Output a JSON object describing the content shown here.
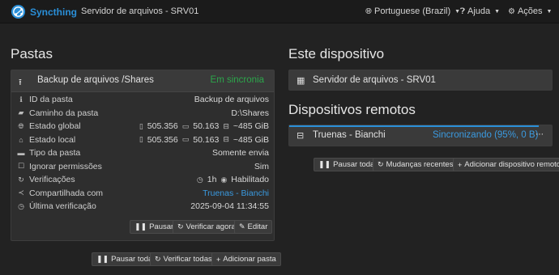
{
  "navbar": {
    "brand": "Syncthing",
    "title": "Servidor de arquivos - SRV01",
    "language": "Portuguese (Brazil)",
    "help": "Ajuda",
    "actions": "Ações"
  },
  "folders": {
    "heading": "Pastas",
    "folder": {
      "name": "Backup de arquivos /Shares",
      "status": "Em sincronia",
      "rows": {
        "id_label": "ID da pasta",
        "id_value": "Backup de arquivos",
        "path_label": "Caminho da pasta",
        "path_value": "D:\\Shares",
        "global_label": "Estado global",
        "global_files": "505.356",
        "global_dirs": "50.163",
        "global_size": "~485 GiB",
        "local_label": "Estado local",
        "local_files": "505.356",
        "local_dirs": "50.163",
        "local_size": "~485 GiB",
        "type_label": "Tipo da pasta",
        "type_value": "Somente envia",
        "perm_label": "Ignorar permissões",
        "perm_value": "Sim",
        "verif_label": "Verificações",
        "verif_interval": "1h",
        "verif_watch": "Habilitado",
        "shared_label": "Compartilhada com",
        "shared_value": "Truenas - Bianchi",
        "last_label": "Última verificação",
        "last_value": "2025-09-04 11:34:55"
      },
      "buttons": {
        "pause": "Pausar",
        "rescan": "Verificar agora",
        "edit": "Editar"
      }
    },
    "actions": {
      "pause_all": "Pausar todas",
      "rescan_all": "Verificar todas",
      "add": "Adicionar pasta"
    }
  },
  "this_device": {
    "heading": "Este dispositivo",
    "name": "Servidor de arquivos - SRV01"
  },
  "remote": {
    "heading": "Dispositivos remotos",
    "device": {
      "name": "Truenas - Bianchi",
      "status": "Sincronizando (95%, 0 B)",
      "progress": 0.95
    },
    "actions": {
      "pause_all": "Pausar todas",
      "recent": "Mudanças recentes",
      "add": "Adicionar dispositivo remoto"
    }
  },
  "colors": {
    "accent": "#2a8fd8",
    "in_sync": "#2ca64b",
    "link": "#3a9ae0"
  }
}
